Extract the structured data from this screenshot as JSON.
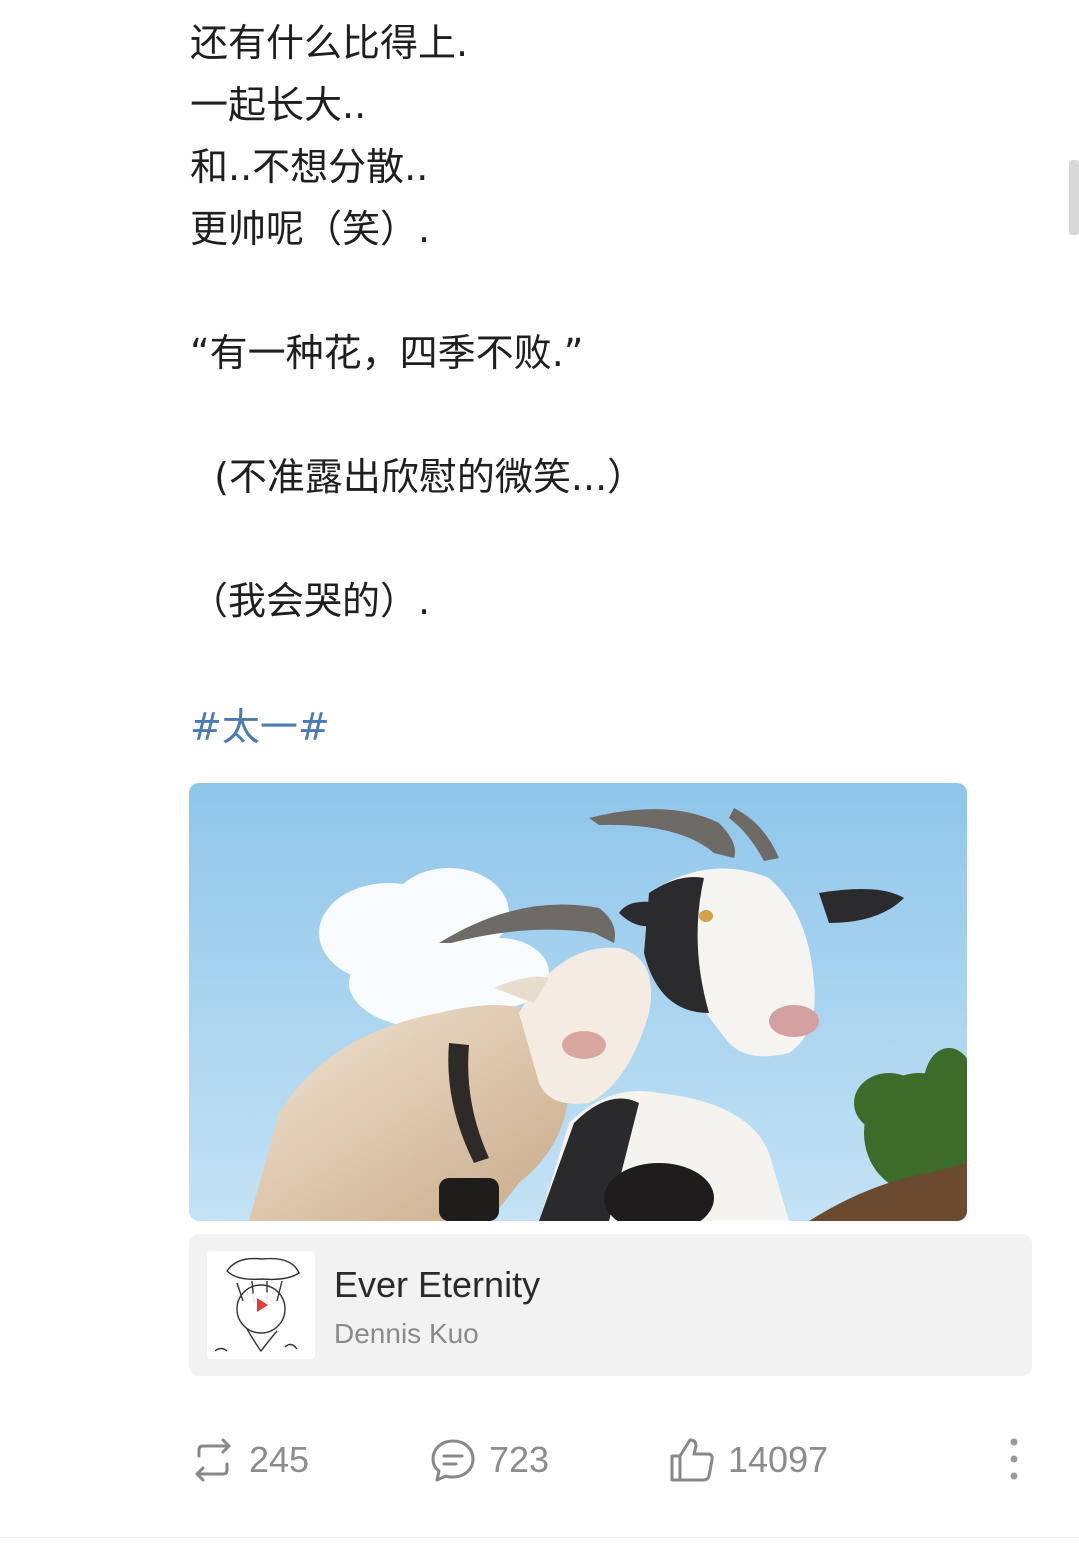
{
  "post": {
    "lines": [
      "还有什么比得上.",
      "一起长大..",
      "和..不想分散..",
      "更帅呢（笑）.",
      "“有一种花，四季不败.”",
      " (不准露出欣慰的微笑...）",
      "（我会哭的）."
    ],
    "hashtag": "#太一#"
  },
  "music": {
    "title": "Ever Eternity",
    "artist": "Dennis Kuo"
  },
  "actions": {
    "repost_count": "245",
    "comment_count": "723",
    "like_count": "14097"
  },
  "colors": {
    "hashtag": "#4b7bb3",
    "play": "#e33b3b"
  }
}
